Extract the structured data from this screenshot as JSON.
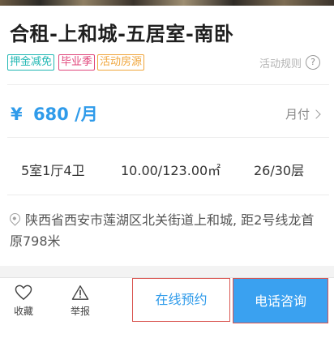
{
  "listing": {
    "title": "合租-上和城-五居室-南卧",
    "tags": [
      "押金减免",
      "毕业季",
      "活动房源"
    ],
    "rules_label": "活动规则",
    "rules_icon": "question-circle-icon",
    "price": {
      "currency": "¥",
      "amount": "680",
      "unit": "/月"
    },
    "payment_label": "月付",
    "specs": {
      "layout": "5室1厅4卫",
      "area": "10.00/123.00㎡",
      "floor": "26/30层"
    },
    "address": "陕西省西安市莲湖区北关街道上和城, 距2号线龙首原798米"
  },
  "bottom_bar": {
    "favorite_label": "收藏",
    "report_label": "举报",
    "reserve_label": "在线预约",
    "call_label": "电话咨询"
  },
  "colors": {
    "accent_blue": "#2f9bea",
    "call_button_bg": "#3aa1f0",
    "tag_teal": "#21b7b3",
    "tag_pink": "#e0457a",
    "tag_orange": "#f0a63c",
    "highlight_border": "#d9534f"
  }
}
